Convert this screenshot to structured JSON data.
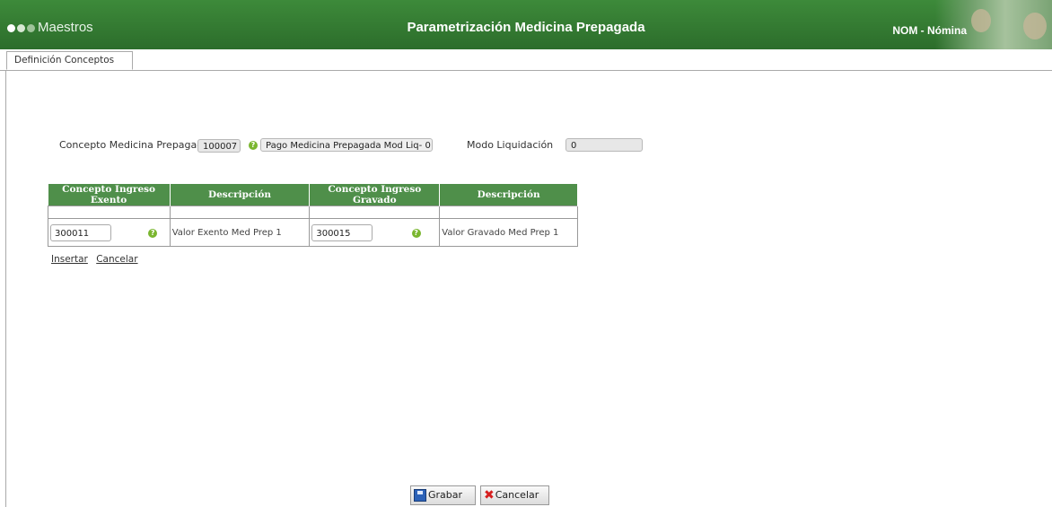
{
  "header": {
    "module": "Maestros",
    "title": "Parametrización Medicina Prepagada",
    "user_module": "NOM - Nómina",
    "dot_colors": [
      "#ffffff",
      "#d8e8d4",
      "#9fc39a"
    ]
  },
  "tabs": [
    {
      "label": "Definición Conceptos"
    }
  ],
  "form": {
    "concepto_label": "Concepto Medicina Prepagada",
    "concepto_code": "100007",
    "concepto_desc": "Pago Medicina Prepagada Mod Liq- 0",
    "modo_label": "Modo Liquidación",
    "modo_value": "0"
  },
  "grid": {
    "headers": [
      "Concepto Ingreso Exento",
      "Descripción",
      "Concepto Ingreso Gravado",
      "Descripción"
    ],
    "row": {
      "exento_code": "300011",
      "exento_desc": "Valor Exento Med Prep 1",
      "gravado_code": "300015",
      "gravado_desc": "Valor Gravado Med Prep 1"
    }
  },
  "links": {
    "insert": "Insertar",
    "cancel": "Cancelar"
  },
  "buttons": {
    "save": "Grabar",
    "cancel": "Cancelar"
  }
}
